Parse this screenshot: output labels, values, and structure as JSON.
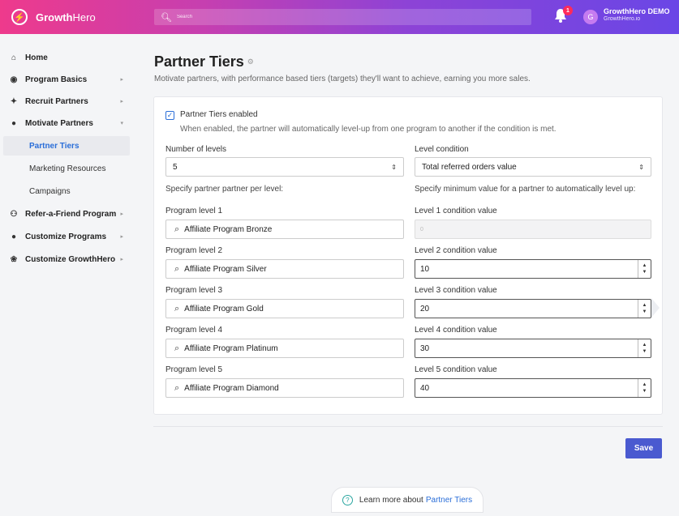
{
  "topbar": {
    "brand_strong": "Growth",
    "brand_light": "Hero",
    "search_placeholder": "Search",
    "notification_count": "1",
    "avatar_initial": "G",
    "user_name": "GrowthHero DEMO",
    "user_domain": "GrowthHero.io"
  },
  "sidebar": {
    "items": [
      {
        "label": "Home",
        "icon": "home-icon"
      },
      {
        "label": "Program Basics",
        "icon": "user-circle-icon"
      },
      {
        "label": "Recruit Partners",
        "icon": "handshake-icon"
      },
      {
        "label": "Motivate Partners",
        "icon": "dollar-circle-icon"
      },
      {
        "label": "Refer-a-Friend Program",
        "icon": "users-icon"
      },
      {
        "label": "Customize Programs",
        "icon": "toggle-icon"
      },
      {
        "label": "Customize GrowthHero",
        "icon": "palette-icon"
      }
    ],
    "subitems": [
      {
        "label": "Partner Tiers",
        "active": true
      },
      {
        "label": "Marketing Resources"
      },
      {
        "label": "Campaigns"
      }
    ]
  },
  "page": {
    "title": "Partner Tiers",
    "subtitle": "Motivate partners, with performance based tiers (targets) they'll want to achieve, earning you more sales."
  },
  "form": {
    "enabled_label": "Partner Tiers enabled",
    "enabled_hint": "When enabled, the partner will automatically level-up from one program to another if the condition is met.",
    "levels_label": "Number of levels",
    "levels_value": "5",
    "condition_label": "Level condition",
    "condition_value": "Total referred orders value",
    "left_hint": "Specify partner partner per level:",
    "right_hint": "Specify minimum value for a partner to automatically level up:",
    "levels": [
      {
        "label": "Program level 1",
        "program": "Affiliate Program Bronze",
        "cond_label": "Level 1 condition value",
        "cond_value": "0"
      },
      {
        "label": "Program level 2",
        "program": "Affiliate Program Silver",
        "cond_label": "Level 2 condition value",
        "cond_value": "10"
      },
      {
        "label": "Program level 3",
        "program": "Affiliate Program Gold",
        "cond_label": "Level 3 condition value",
        "cond_value": "20"
      },
      {
        "label": "Program level 4",
        "program": "Affiliate Program Platinum",
        "cond_label": "Level 4 condition value",
        "cond_value": "30"
      },
      {
        "label": "Program level 5",
        "program": "Affiliate Program Diamond",
        "cond_label": "Level 5 condition value",
        "cond_value": "40"
      }
    ]
  },
  "actions": {
    "save_label": "Save",
    "learn_text": "Learn more about",
    "learn_link": "Partner Tiers"
  }
}
